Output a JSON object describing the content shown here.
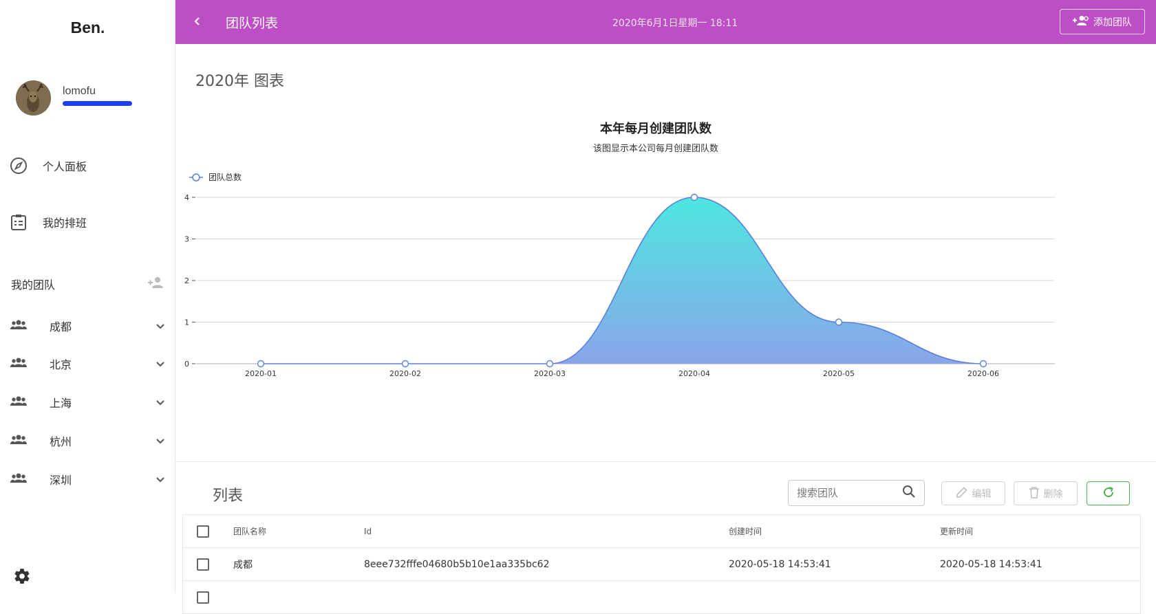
{
  "sidebar": {
    "logo": "Ben.",
    "username": "lomofu",
    "nav": [
      {
        "label": "个人面板",
        "icon": "compass-icon"
      },
      {
        "label": "我的排班",
        "icon": "clipboard-list-icon"
      }
    ],
    "my_teams_label": "我的团队",
    "teams": [
      {
        "label": "成都"
      },
      {
        "label": "北京"
      },
      {
        "label": "上海"
      },
      {
        "label": "杭州"
      },
      {
        "label": "深圳"
      }
    ]
  },
  "topbar": {
    "title": "团队列表",
    "datetime": "2020年6月1日星期一 18:11",
    "add_team_label": "添加团队"
  },
  "section": {
    "chart_heading": "2020年 图表",
    "list_heading": "列表"
  },
  "chart_data": {
    "type": "area",
    "title": "本年每月创建团队数",
    "subtitle": "该图显示本公司每月创建团队数",
    "legend": [
      "团队总数"
    ],
    "legend_position": "top-left",
    "x": [
      "2020-01",
      "2020-02",
      "2020-03",
      "2020-04",
      "2020-05",
      "2020-06"
    ],
    "series": [
      {
        "name": "团队总数",
        "values": [
          0,
          0,
          0,
          4,
          1,
          0
        ]
      }
    ],
    "yticks": [
      0,
      1,
      2,
      3,
      4
    ],
    "ylim": [
      0,
      4
    ],
    "grid": true,
    "colors": {
      "line": "#5b7fd8",
      "fill_top": "#4ee6e0",
      "fill_bottom": "#8aa5ea"
    }
  },
  "toolbar": {
    "search_placeholder": "搜索团队",
    "edit_label": "编辑",
    "delete_label": "删除"
  },
  "table": {
    "columns": [
      "团队名称",
      "Id",
      "创建时间",
      "更新时间"
    ],
    "rows": [
      {
        "name": "成都",
        "id": "8eee732fffe04680b5b10e1aa335bc62",
        "created": "2020-05-18 14:53:41",
        "updated": "2020-05-18 14:53:41"
      }
    ]
  },
  "colors": {
    "topbar": "#bd4ec5",
    "profile_bar": "#1a3ff0",
    "refresh": "#4caf50"
  }
}
